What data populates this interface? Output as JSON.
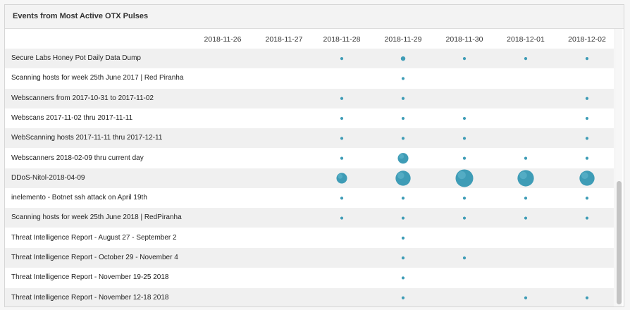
{
  "panel": {
    "title": "Events from Most Active OTX Pulses"
  },
  "colors": {
    "dot": "#3e9cb6",
    "dot_highlight": "#7ccbe0"
  },
  "chart_data": {
    "type": "scatter",
    "subtype": "bubble-matrix",
    "x": [
      "2018-11-26",
      "2018-11-27",
      "2018-11-28",
      "2018-11-29",
      "2018-11-30",
      "2018-12-01",
      "2018-12-02"
    ],
    "rows": [
      "Secure Labs Honey Pot Daily Data Dump",
      "Scanning hosts for week 25th June 2017 | Red Piranha",
      "Webscanners from 2017-10-31 to 2017-11-02",
      "Webscans 2017-11-02 thru 2017-11-11",
      "WebScanning hosts 2017-11-11 thru 2017-12-11",
      "Webscanners 2018-02-09 thru current day",
      "DDoS-Nitol-2018-04-09",
      "inelemento - Botnet ssh attack on April 19th",
      "Scanning hosts for week 25th June 2018 | RedPiranha",
      "Threat Intelligence Report - August 27 - September 2",
      "Threat Intelligence Report - October 29 - November 4",
      "Threat Intelligence Report - November 19-25 2018",
      "Threat Intelligence Report - November 12-18 2018"
    ],
    "values": [
      [
        0,
        0,
        1,
        2,
        1,
        1,
        1
      ],
      [
        0,
        0,
        0,
        1,
        0,
        0,
        0
      ],
      [
        0,
        0,
        1,
        1,
        0,
        0,
        1
      ],
      [
        0,
        0,
        1,
        1,
        1,
        0,
        1
      ],
      [
        0,
        0,
        1,
        1,
        1,
        0,
        1
      ],
      [
        0,
        0,
        1,
        8,
        1,
        1,
        1
      ],
      [
        0,
        0,
        8,
        16,
        22,
        19,
        16
      ],
      [
        0,
        0,
        1,
        1,
        1,
        1,
        1
      ],
      [
        0,
        0,
        1,
        1,
        1,
        1,
        1
      ],
      [
        0,
        0,
        0,
        1,
        0,
        0,
        0
      ],
      [
        0,
        0,
        0,
        1,
        1,
        0,
        0
      ],
      [
        0,
        0,
        0,
        1,
        0,
        0,
        0
      ],
      [
        0,
        0,
        0,
        1,
        0,
        1,
        1
      ]
    ],
    "value_note": "relative bubble magnitude",
    "grid": false,
    "legend": "none"
  }
}
